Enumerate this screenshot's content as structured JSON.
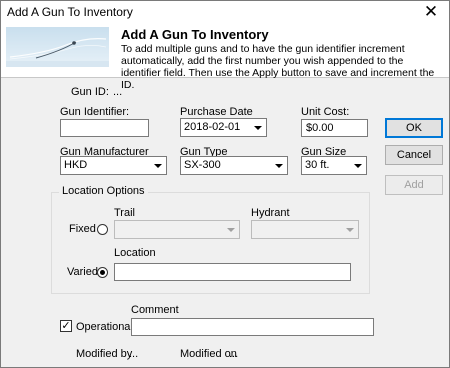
{
  "window": {
    "title": "Add A Gun To Inventory",
    "close_glyph": "✕"
  },
  "banner": {
    "title": "Add A Gun To Inventory",
    "description": "To add multiple guns and to have the gun identifier increment automatically, add the first number you wish appended to the identifier field.  Then use the Apply button to save and increment the ID.",
    "image_icon": "fire-hose-spray-icon"
  },
  "gun_id": {
    "label": "Gun ID:",
    "value": "..."
  },
  "gun_identifier": {
    "label": "Gun Identifier:",
    "value": ""
  },
  "purchase_date": {
    "label": "Purchase Date",
    "value": "2018-02-01"
  },
  "unit_cost": {
    "label": "Unit Cost:",
    "value": "$0.00"
  },
  "gun_manufacturer": {
    "label": "Gun Manufacturer",
    "value": "HKD"
  },
  "gun_type": {
    "label": "Gun Type",
    "value": "SX-300"
  },
  "gun_size": {
    "label": "Gun Size",
    "value": "30 ft."
  },
  "buttons": {
    "ok": "OK",
    "cancel": "Cancel",
    "add": "Add"
  },
  "location_options": {
    "legend": "Location Options",
    "fixed_label": "Fixed",
    "varied_label": "Varied",
    "selected": "varied",
    "trail": {
      "label": "Trail",
      "value": ""
    },
    "hydrant": {
      "label": "Hydrant",
      "value": ""
    },
    "location": {
      "label": "Location",
      "value": ""
    }
  },
  "operational": {
    "label": "Operational",
    "checked": true,
    "check_glyph": "✓"
  },
  "comment": {
    "label": "Comment",
    "value": ""
  },
  "modified_by": {
    "label": "Modified by",
    "value": "..."
  },
  "modified_on": {
    "label": "Modified on",
    "value": "..."
  },
  "colors": {
    "accent": "#0078d7",
    "window_bg": "#f0f0f0"
  }
}
